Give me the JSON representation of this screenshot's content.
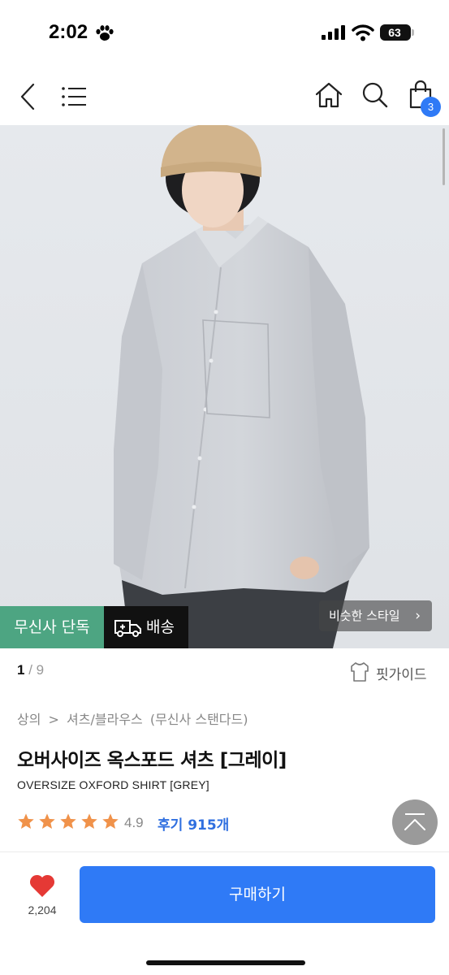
{
  "status_bar": {
    "time": "2:02",
    "battery": "63"
  },
  "nav": {
    "cart_count": "3"
  },
  "hero": {
    "tag_exclusive": "무신사 단독",
    "tag_shipping": "배송",
    "similar_style": "비슷한 스타일",
    "similar_chevron": "›"
  },
  "pager": {
    "current": "1",
    "separator": " / ",
    "total": "9"
  },
  "fit_guide": "핏가이드",
  "breadcrumb": [
    "상의",
    ">",
    "셔츠/블라우스",
    "(무신사 스탠다드)"
  ],
  "product": {
    "title_ko": "오버사이즈 옥스포드 셔츠 [그레이]",
    "title_en": "OVERSIZE OXFORD SHIRT [GREY]",
    "rating": 4.9,
    "rating_text": "4.9",
    "review_link": "후기 915개"
  },
  "bottom_bar": {
    "like_count": "2,204",
    "buy_label": "구매하기"
  },
  "colors": {
    "accent": "#2f7af6",
    "exclusive_tag": "#4da582",
    "star": "#f0924a",
    "like": "#e53935"
  },
  "icons": [
    "paw-icon",
    "signal-icon",
    "wifi-icon",
    "back-icon",
    "menu-icon",
    "home-icon",
    "search-icon",
    "shopping-bag-icon",
    "truck-icon",
    "shirt-icon",
    "star-icon",
    "heart-icon",
    "arrow-up-icon"
  ]
}
